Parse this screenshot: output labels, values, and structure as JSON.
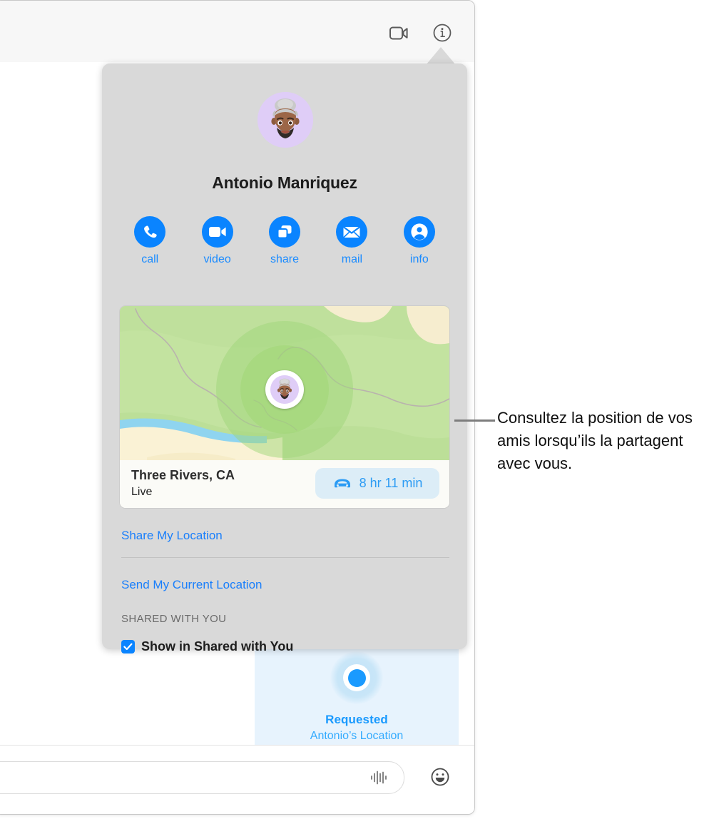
{
  "window": {
    "toolbar": {
      "facetime_icon": "video-camera-icon",
      "info_icon": "info-circle-icon"
    },
    "compose": {
      "placeholder": "",
      "value": "",
      "audio_icon": "audio-waveform-icon",
      "emoji_icon": "smiley-face-icon"
    },
    "message_bubble": {
      "pin_icon": "location-dot-icon",
      "title": "Requested",
      "subtitle": "Antonio’s Location"
    }
  },
  "popover": {
    "avatar": "memoji-avatar",
    "contact_name": "Antonio Manriquez",
    "actions": [
      {
        "label": "call",
        "icon": "phone-icon"
      },
      {
        "label": "video",
        "icon": "video-camera-icon"
      },
      {
        "label": "share",
        "icon": "share-windows-icon"
      },
      {
        "label": "mail",
        "icon": "envelope-icon"
      },
      {
        "label": "info",
        "icon": "person-circle-icon"
      }
    ],
    "map": {
      "pin_avatar": "memoji-avatar",
      "place": "Three Rivers, CA",
      "status": "Live",
      "eta": "8 hr 11 min",
      "eta_icon": "car-icon"
    },
    "links": {
      "share_my_location": "Share My Location",
      "send_my_current_location": "Send My Current Location"
    },
    "shared_with_you": {
      "header": "SHARED WITH YOU",
      "checkbox_label": "Show in Shared with You",
      "checked": true
    }
  },
  "callout": {
    "text": "Consultez la position de vos amis lorsqu’ils la partagent avec vous."
  },
  "colors": {
    "accent_blue": "#0a84ff",
    "link_blue": "#1a7ffb",
    "bubble_blue": "#e7f3fd",
    "popover_gray": "#d9d9d9",
    "map_green": "#c3e3a0",
    "map_sand": "#faf2d5",
    "map_water": "#8fd4ef"
  }
}
